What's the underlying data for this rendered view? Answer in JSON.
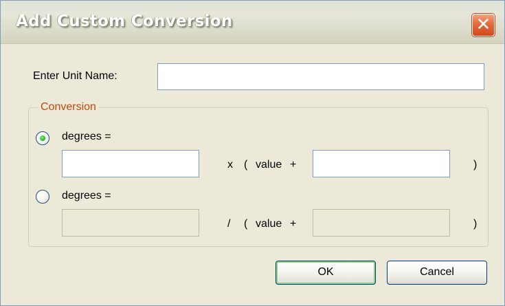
{
  "window": {
    "title": "Add Custom Conversion",
    "close_glyph": "✕"
  },
  "form": {
    "unit_name_label": "Enter Unit Name:",
    "unit_name_value": ""
  },
  "conversion": {
    "group_label": "Conversion",
    "options": [
      {
        "selected": true,
        "label": "degrees =",
        "operator": "x",
        "open_paren": "(",
        "value_label": "value",
        "plus": "+",
        "close_paren": ")",
        "factor_value": "",
        "offset_value": "",
        "enabled": true
      },
      {
        "selected": false,
        "label": "degrees =",
        "operator": "/",
        "open_paren": "(",
        "value_label": "value",
        "plus": "+",
        "close_paren": ")",
        "factor_value": "",
        "offset_value": "",
        "enabled": false
      }
    ]
  },
  "buttons": {
    "ok_label": "OK",
    "cancel_label": "Cancel"
  },
  "colors": {
    "group_label": "#c04a0a",
    "radio_selected": "#34b534",
    "close_button": "#e5693d"
  },
  "icons": {
    "close": "close-icon"
  }
}
